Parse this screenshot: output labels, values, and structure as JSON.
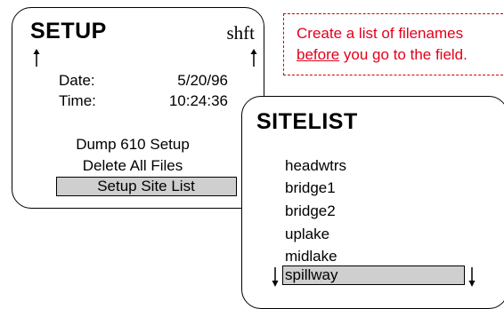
{
  "setup": {
    "title": "SETUP",
    "shift_label": "shft",
    "date_label": "Date:",
    "date_value": "5/20/96",
    "time_label": "Time:",
    "time_value": "10:24:36",
    "menu": [
      "Dump 610 Setup",
      "Delete All Files",
      "Setup Site List"
    ],
    "selected_index": 2
  },
  "note": {
    "line1": "Create a list of filenames",
    "underlined": "before",
    "line2_rest": " you go to the field.",
    "color": "#e3001b"
  },
  "sitelist": {
    "title": "SITELIST",
    "items": [
      "headwtrs",
      "bridge1",
      "bridge2",
      "uplake",
      "midlake",
      "spillway"
    ],
    "selected_index": 5,
    "highlight_color": "#cfcfcf"
  }
}
